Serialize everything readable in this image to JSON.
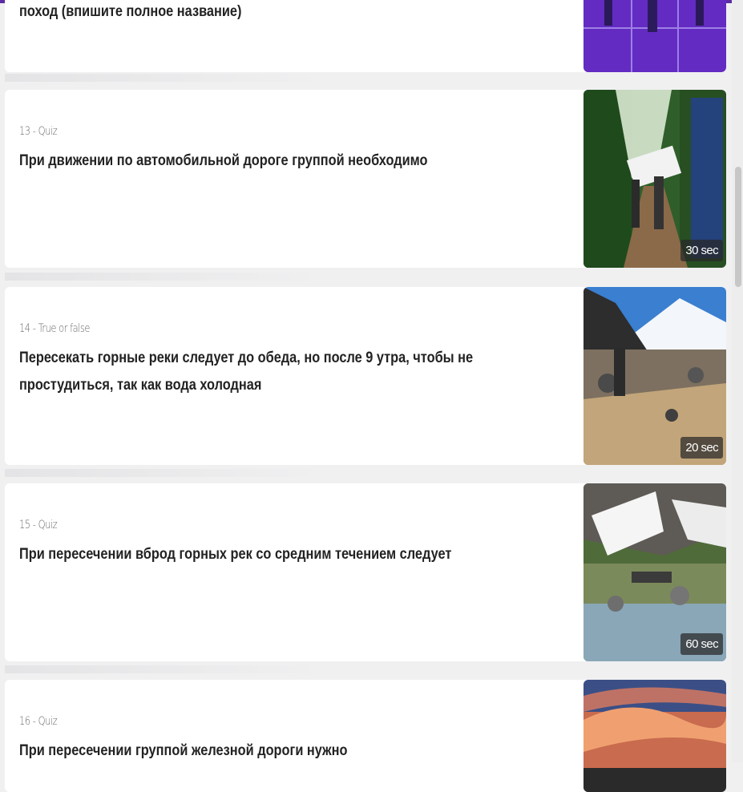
{
  "questions": [
    {
      "meta": "",
      "title": "поход (впишите полное название)",
      "time": ""
    },
    {
      "meta": "13 - Quiz",
      "title": "При движении по автомобильной дороге группой необходимо",
      "time": "30 sec"
    },
    {
      "meta": "14 - True or false",
      "title": "Пересекать горные реки следует до обеда, но после 9 утра, чтобы не простудиться, так как вода холодная",
      "time": "20 sec"
    },
    {
      "meta": "15 - Quiz",
      "title": "При пересечении вброд горных рек со средним течением следует",
      "time": "60 sec"
    },
    {
      "meta": "16 - Quiz",
      "title": "При пересечении группой железной дороги нужно",
      "time": ""
    }
  ],
  "thumbnails": [
    {
      "icon": "hikers-purple-image"
    },
    {
      "icon": "forest-trail-sign-image"
    },
    {
      "icon": "mountain-river-image"
    },
    {
      "icon": "snowy-valley-river-image"
    },
    {
      "icon": "sunset-sky-image"
    }
  ],
  "colors": {
    "accent": "#5b2ca3",
    "card": "#ffffff",
    "background": "#f0f0f1",
    "title": "#222222",
    "meta": "#6b6b6b"
  }
}
